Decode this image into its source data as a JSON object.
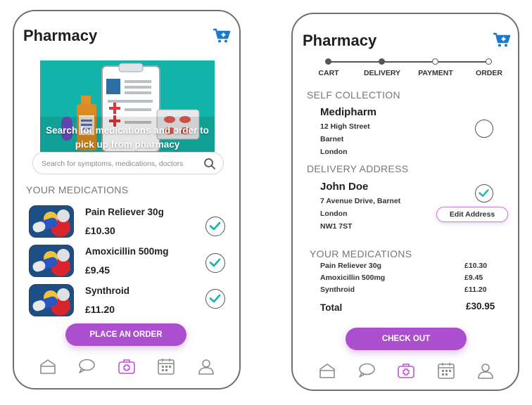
{
  "left_screen": {
    "title": "Pharmacy",
    "cart_icon": "cart-plus-icon",
    "hero": {
      "text_line1": "Search for medications and order to",
      "text_line2": "pick up from pharmacy",
      "bg_color": "#12b3a8"
    },
    "search": {
      "placeholder": "Search for symptoms, medications, doctors",
      "icon": "search-icon"
    },
    "section_title": "YOUR MEDICATIONS",
    "medications": [
      {
        "name": "Pain Reliever 30g",
        "price": "£10.30",
        "selected": true
      },
      {
        "name": "Amoxicillin 500mg",
        "price": "£9.45",
        "selected": true
      },
      {
        "name": "Synthroid",
        "price": "£11.20",
        "selected": true
      }
    ],
    "order_button": "PLACE AN ORDER"
  },
  "right_screen": {
    "title": "Pharmacy",
    "cart_icon": "cart-plus-icon",
    "steps": [
      {
        "label": "CART",
        "done": true
      },
      {
        "label": "DELIVERY",
        "done": true
      },
      {
        "label": "PAYMENT",
        "done": false
      },
      {
        "label": "ORDER",
        "done": false
      }
    ],
    "self_collection": {
      "heading": "SELF COLLECTION",
      "name": "Medipharm",
      "address": [
        "12 High Street",
        "Barnet",
        "London"
      ],
      "selected": false
    },
    "delivery": {
      "heading": "DELIVERY ADDRESS",
      "name": "John Doe",
      "address": [
        "7 Avenue Drive, Barnet",
        "London",
        "NW1 7ST"
      ],
      "selected": true,
      "edit_label": "Edit Address"
    },
    "summary": {
      "heading": "YOUR MEDICATIONS",
      "items": [
        {
          "name": "Pain Reliever 30g",
          "price": "£10.30"
        },
        {
          "name": "Amoxicillin 500mg",
          "price": "£9.45"
        },
        {
          "name": "Synthroid",
          "price": "£11.20"
        }
      ],
      "total_label": "Total",
      "total_value": "£30.95"
    },
    "checkout_button": "CHECK OUT"
  },
  "bottom_nav": {
    "icons": [
      "home-icon",
      "chat-icon",
      "medical-kit-icon",
      "calendar-icon",
      "profile-icon"
    ],
    "active": "medical-kit-icon"
  },
  "colors": {
    "accent": "#ab4fce",
    "check": "#16b3a6",
    "teal_banner": "#12b3a8",
    "nav_gray": "#8c8c8c"
  }
}
